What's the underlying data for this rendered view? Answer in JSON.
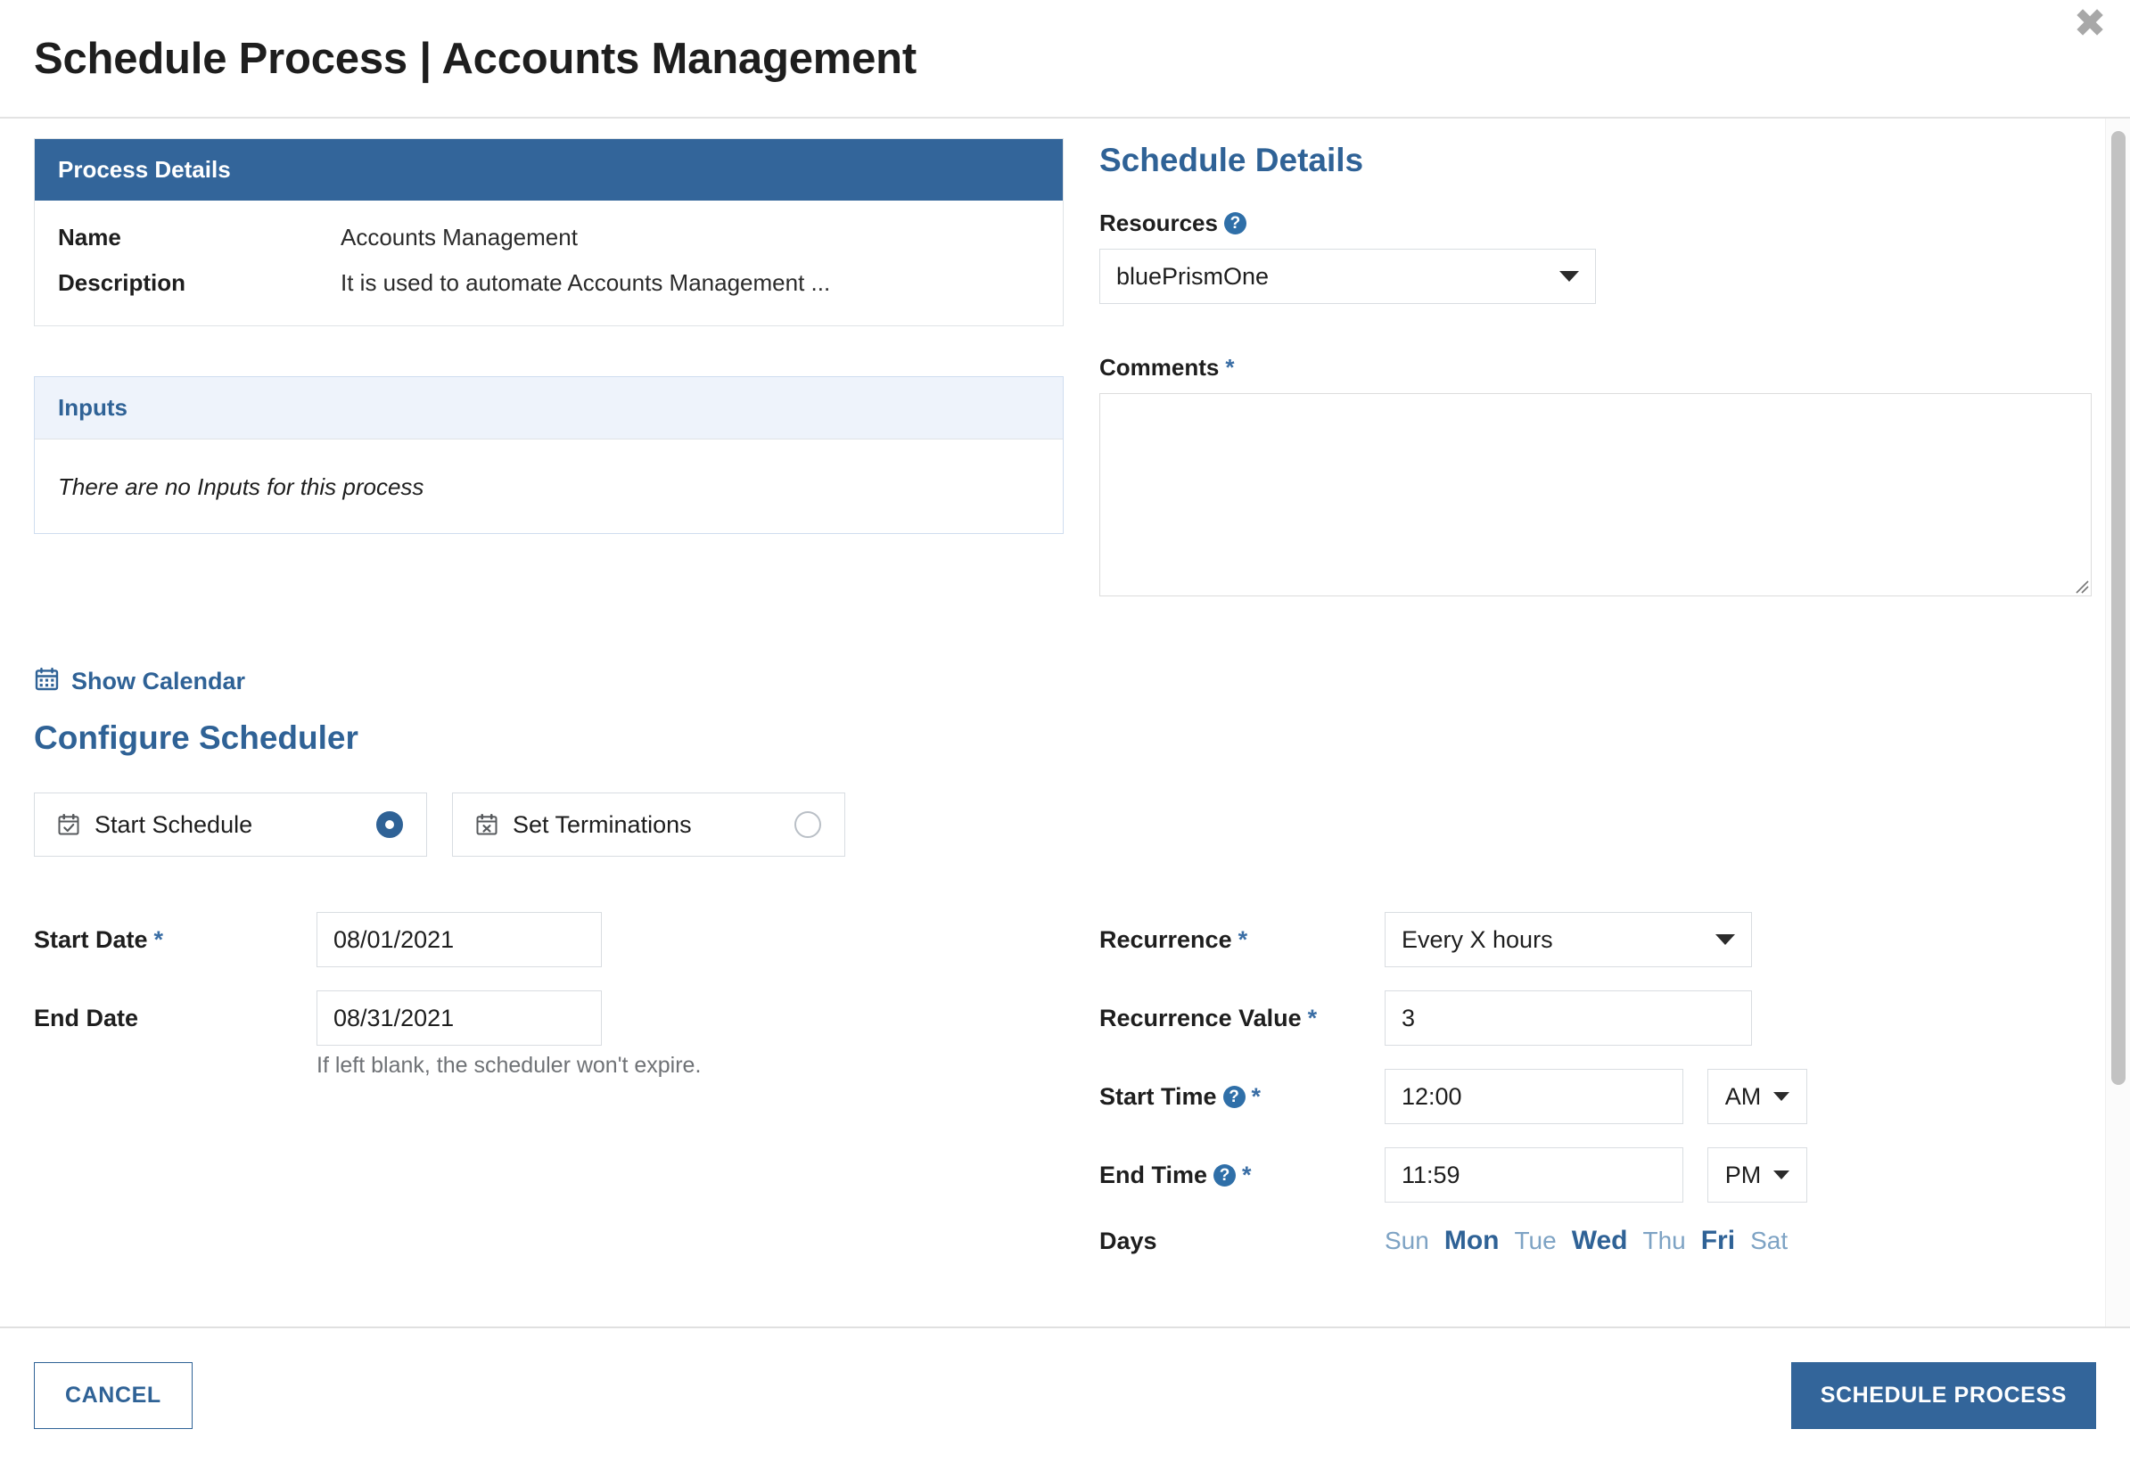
{
  "header": {
    "title": "Schedule Process | Accounts Management",
    "close_label": "✖"
  },
  "process_details": {
    "panel_title": "Process Details",
    "rows": [
      {
        "key": "Name",
        "value": "Accounts Management"
      },
      {
        "key": "Description",
        "value": "It is used to automate Accounts Management ..."
      }
    ]
  },
  "inputs_panel": {
    "panel_title": "Inputs",
    "empty_message": "There are no Inputs for this process"
  },
  "schedule_details": {
    "section_title": "Schedule Details",
    "resources_label": "Resources",
    "resources_help": "?",
    "resources_value": "bluePrismOne",
    "comments_label": "Comments",
    "comments_required": "*",
    "comments_value": "",
    "comments_placeholder": ""
  },
  "calendar_link": {
    "label": "Show Calendar",
    "icon": "calendar-icon"
  },
  "configure_scheduler": {
    "section_title": "Configure Scheduler",
    "modes": [
      {
        "label": "Start Schedule",
        "icon": "calendar-check-icon",
        "selected": true
      },
      {
        "label": "Set Terminations",
        "icon": "calendar-x-icon",
        "selected": false
      }
    ],
    "start_date_label": "Start Date",
    "start_date_required": "*",
    "start_date_value": "08/01/2021",
    "end_date_label": "End Date",
    "end_date_value": "08/31/2021",
    "end_date_hint": "If left blank, the scheduler won't expire.",
    "recurrence_label": "Recurrence",
    "recurrence_required": "*",
    "recurrence_value": "Every X hours",
    "recurrence_value_label": "Recurrence Value",
    "recurrence_value_required": "*",
    "recurrence_value_value": "3",
    "start_time_label": "Start Time",
    "start_time_required": "*",
    "start_time_help": "?",
    "start_time_value": "12:00",
    "start_time_meridiem": "AM",
    "end_time_label": "End Time",
    "end_time_required": "*",
    "end_time_help": "?",
    "end_time_value": "11:59",
    "end_time_meridiem": "PM",
    "days_label": "Days",
    "days": [
      {
        "label": "Sun",
        "selected": false
      },
      {
        "label": "Mon",
        "selected": true
      },
      {
        "label": "Tue",
        "selected": false
      },
      {
        "label": "Wed",
        "selected": true
      },
      {
        "label": "Thu",
        "selected": false
      },
      {
        "label": "Fri",
        "selected": true
      },
      {
        "label": "Sat",
        "selected": false
      }
    ]
  },
  "footer": {
    "cancel_label": "CANCEL",
    "submit_label": "SCHEDULE PROCESS"
  },
  "colors": {
    "brand_blue": "#33659a",
    "link_blue": "#2f6296",
    "light_blue_panel": "#eef3fb",
    "day_unselected": "#7ea3c4"
  }
}
